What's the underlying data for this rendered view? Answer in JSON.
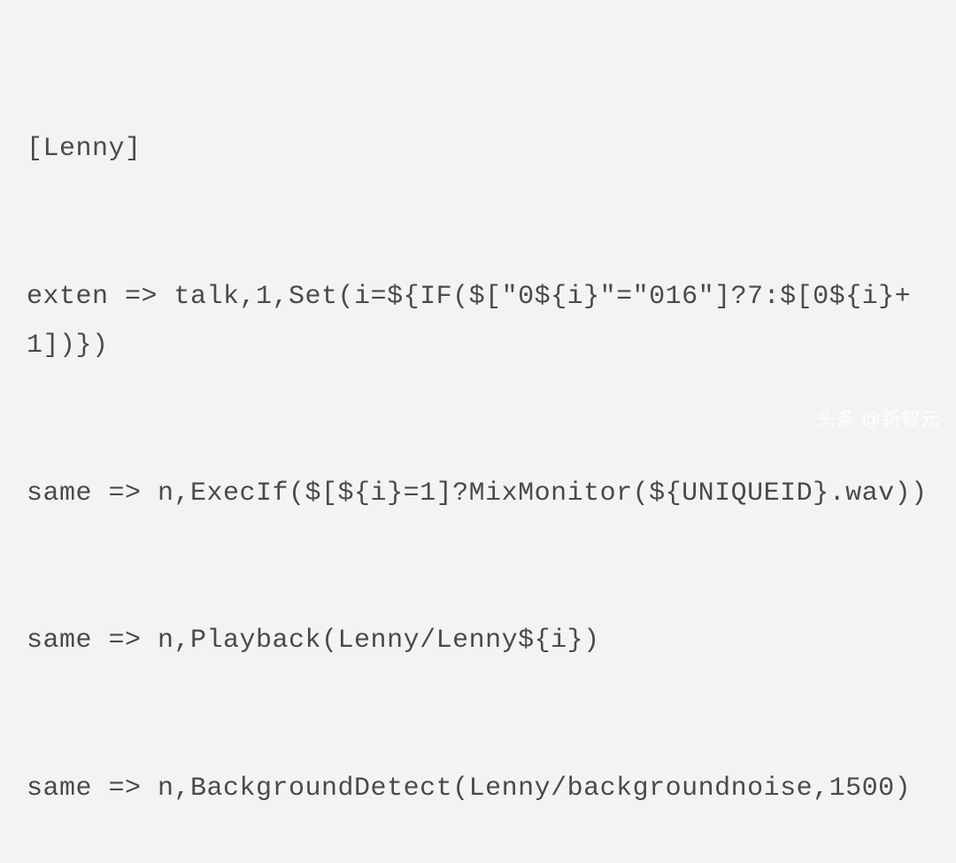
{
  "code": {
    "lines": [
      "[Lenny]",
      "exten => talk,1,Set(i=${IF($[\"0${i}\"=\"016\"]?7:$[0${i}+1])})",
      "same => n,ExecIf($[${i}=1]?MixMonitor(${UNIQUEID}.wav))",
      "same => n,Playback(Lenny/Lenny${i})",
      "same => n,BackgroundDetect(Lenny/backgroundnoise,1500)"
    ]
  },
  "watermark": {
    "text": "头条 @新智元"
  }
}
